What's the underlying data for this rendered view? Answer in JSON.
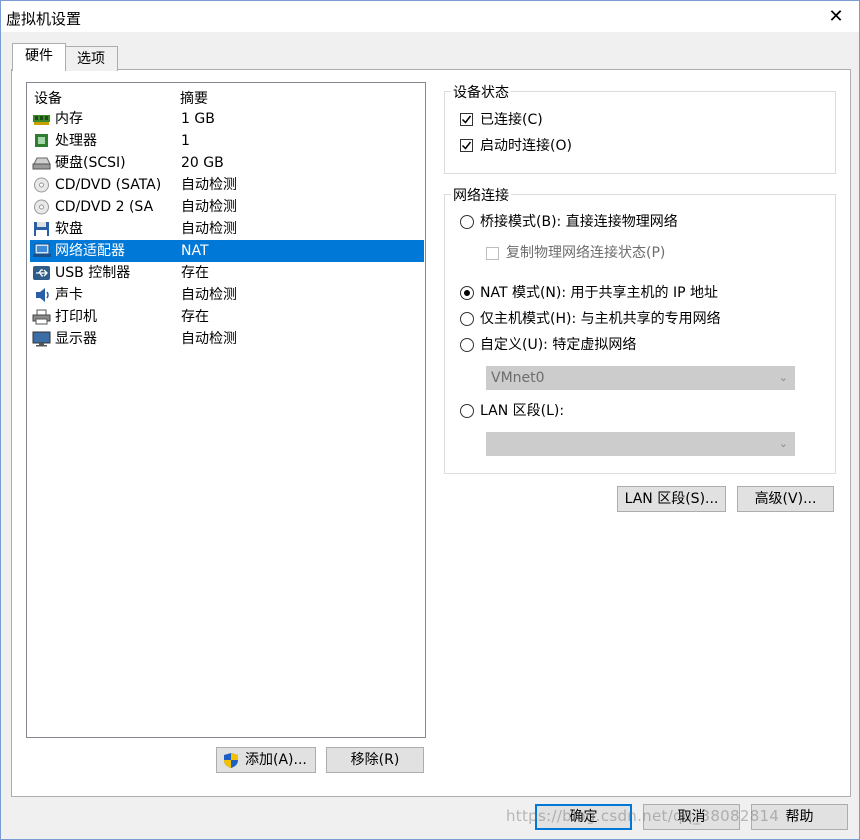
{
  "window": {
    "title": "虚拟机设置",
    "close_glyph": "✕"
  },
  "tabs": [
    {
      "label": "硬件"
    },
    {
      "label": "选项"
    }
  ],
  "device_list": {
    "headers": {
      "device": "设备",
      "summary": "摘要"
    },
    "rows": [
      {
        "device": "内存",
        "summary": "1 GB",
        "icon": "memory-icon"
      },
      {
        "device": "处理器",
        "summary": "1",
        "icon": "cpu-icon"
      },
      {
        "device": "硬盘(SCSI)",
        "summary": "20 GB",
        "icon": "hard-disk-icon"
      },
      {
        "device": "CD/DVD (SATA)",
        "summary": "自动检测",
        "icon": "cd-icon"
      },
      {
        "device": "CD/DVD 2 (SA",
        "summary": "自动检测",
        "icon": "cd-icon"
      },
      {
        "device": "软盘",
        "summary": "自动检测",
        "icon": "floppy-icon"
      },
      {
        "device": "网络适配器",
        "summary": "NAT",
        "icon": "network-adapter-icon",
        "selected": true
      },
      {
        "device": "USB 控制器",
        "summary": "存在",
        "icon": "usb-icon"
      },
      {
        "device": "声卡",
        "summary": "自动检测",
        "icon": "sound-card-icon"
      },
      {
        "device": "打印机",
        "summary": "存在",
        "icon": "printer-icon"
      },
      {
        "device": "显示器",
        "summary": "自动检测",
        "icon": "monitor-icon"
      }
    ],
    "add_button": "添加(A)...",
    "remove_button": "移除(R)"
  },
  "device_status": {
    "title": "设备状态",
    "connected": {
      "label": "已连接(C)",
      "checked": true
    },
    "connect_at_power_on": {
      "label": "启动时连接(O)",
      "checked": true
    }
  },
  "network": {
    "title": "网络连接",
    "bridged": {
      "label": "桥接模式(B): 直接连接物理网络",
      "selected": false
    },
    "replicate": {
      "label": "复制物理网络连接状态(P)",
      "checked": false,
      "enabled": false
    },
    "nat": {
      "label": "NAT 模式(N): 用于共享主机的 IP 地址",
      "selected": true
    },
    "host_only": {
      "label": "仅主机模式(H): 与主机共享的专用网络",
      "selected": false
    },
    "custom": {
      "label": "自定义(U): 特定虚拟网络",
      "selected": false
    },
    "custom_select": {
      "value": "VMnet0",
      "enabled": false
    },
    "lan_segment": {
      "label": "LAN 区段(L):",
      "selected": false
    },
    "lan_select": {
      "value": "",
      "enabled": false
    }
  },
  "network_buttons": {
    "lan_segments": "LAN 区段(S)...",
    "advanced": "高级(V)..."
  },
  "footer": {
    "ok": "确定",
    "cancel": "取消",
    "help": "帮助"
  },
  "watermark": "https://blog.csdn.net/qq_38082814",
  "colors": {
    "selection": "#0078d7",
    "window_border": "#7a9cd3",
    "button_face": "#e1e1e1"
  }
}
